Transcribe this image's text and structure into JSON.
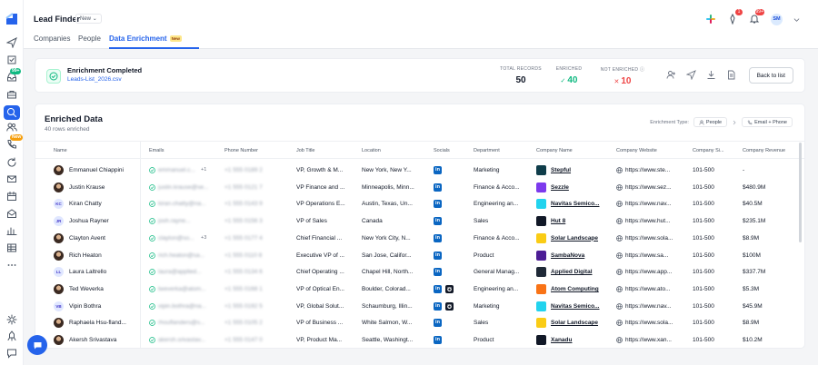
{
  "app": {
    "title": "Lead Finder",
    "version_label": "New"
  },
  "topbar": {
    "avatar_initials": "SM",
    "badges": [
      "1",
      "99+"
    ]
  },
  "sidebar": {
    "leads_badge": "99+",
    "new_badge": "New",
    "icons": [
      "send-icon",
      "task-icon",
      "inbox-icon",
      "briefcase-icon",
      "search-icon",
      "users-icon",
      "phone-icon",
      "refresh-icon",
      "mail-icon",
      "calendar-icon",
      "mail-open-icon",
      "chart-icon",
      "table-icon",
      "more-icon",
      "settings-icon",
      "rocket-icon",
      "chat-icon"
    ]
  },
  "tabs": [
    {
      "label": "Companies"
    },
    {
      "label": "People"
    },
    {
      "label": "Data Enrichment",
      "badge": "New"
    }
  ],
  "summary": {
    "title": "Enrichment Completed",
    "file": "Leads-List_2026.csv",
    "total_label": "TOTAL RECORDS",
    "total_value": "50",
    "enriched_label": "ENRICHED",
    "enriched_value": "40",
    "not_label": "NOT ENRICHED",
    "not_value": "10",
    "back_label": "Back to list"
  },
  "table": {
    "title": "Enriched Data",
    "subtitle": "40 rows enriched",
    "enrichment_type_label": "Enrichment Type:",
    "type_from": "People",
    "type_to": "Email + Phone",
    "columns": [
      "Name",
      "Emails",
      "Phone Number",
      "Job Title",
      "Location",
      "Socials",
      "Department",
      "Company Name",
      "Company Website",
      "Company Si...",
      "Company Revenue"
    ],
    "rows": [
      {
        "name": "Emmanuel Chiappini",
        "avatar": "photo",
        "initials": "",
        "email": "emmanuel.c...",
        "more": "+1",
        "phone": "+1 555 0189 2",
        "job": "VP, Growth & M...",
        "location": "New York, New Y...",
        "github": false,
        "dept": "Marketing",
        "company": "Stepful",
        "logo": "#0f3d4a",
        "website": "https://www.ste...",
        "size": "101-500",
        "revenue": "-"
      },
      {
        "name": "Justin Krause",
        "avatar": "photo",
        "initials": "",
        "email": "justin.krause@se...",
        "more": "",
        "phone": "+1 555 0121 7",
        "job": "VP Finance and ...",
        "location": "Minneapolis, Minn...",
        "github": false,
        "dept": "Finance & Acco...",
        "company": "Sezzle",
        "logo": "#7c3aed",
        "website": "https://www.sez...",
        "size": "101-500",
        "revenue": "$480.9M"
      },
      {
        "name": "Kiran Chatty",
        "avatar": "init",
        "initials": "KC",
        "email": "kiran.chatty@na...",
        "more": "",
        "phone": "+1 555 0143 9",
        "job": "VP Operations E...",
        "location": "Austin, Texas, Un...",
        "github": false,
        "dept": "Engineering an...",
        "company": "Navitas Semico...",
        "logo": "#22d3ee",
        "website": "https://www.nav...",
        "size": "101-500",
        "revenue": "$40.5M"
      },
      {
        "name": "Joshua Rayner",
        "avatar": "init",
        "initials": "JR",
        "email": "josh.rayne...",
        "more": "",
        "phone": "+1 555 0156 3",
        "job": "VP of Sales",
        "location": "Canada",
        "github": false,
        "dept": "Sales",
        "company": "Hut 8",
        "logo": "#111827",
        "website": "https://www.hut...",
        "size": "101-500",
        "revenue": "$235.1M"
      },
      {
        "name": "Clayton Avent",
        "avatar": "photo",
        "initials": "",
        "email": "clayton@so...",
        "more": "+3",
        "phone": "+1 555 0177 4",
        "job": "Chief Financial ...",
        "location": "New York City, N...",
        "github": false,
        "dept": "Finance & Acco...",
        "company": "Solar Landscape",
        "logo": "#facc15",
        "website": "https://www.sola...",
        "size": "101-500",
        "revenue": "$8.9M"
      },
      {
        "name": "Rich Heaton",
        "avatar": "photo",
        "initials": "",
        "email": "rich.heaton@sa...",
        "more": "",
        "phone": "+1 555 0110 8",
        "job": "Executive VP of ...",
        "location": "San Jose, Califor...",
        "github": false,
        "dept": "Product",
        "company": "SambaNova",
        "logo": "#4c1d95",
        "website": "https://www.sa...",
        "size": "101-500",
        "revenue": "$100M"
      },
      {
        "name": "Laura Laltrello",
        "avatar": "init",
        "initials": "LL",
        "email": "laura@applied...",
        "more": "",
        "phone": "+1 555 0134 6",
        "job": "Chief Operating ...",
        "location": "Chapel Hill, North...",
        "github": false,
        "dept": "General Manag...",
        "company": "Applied Digital",
        "logo": "#1f2937",
        "website": "https://www.app...",
        "size": "101-500",
        "revenue": "$337.7M"
      },
      {
        "name": "Ted Weverka",
        "avatar": "photo",
        "initials": "",
        "email": "tweverka@atom...",
        "more": "",
        "phone": "+1 555 0168 1",
        "job": "VP of Optical En...",
        "location": "Boulder, Colorad...",
        "github": true,
        "dept": "Engineering an...",
        "company": "Atom Computing",
        "logo": "#f97316",
        "website": "https://www.ato...",
        "size": "101-500",
        "revenue": "$5.3M"
      },
      {
        "name": "Vipin Bothra",
        "avatar": "init",
        "initials": "VB",
        "email": "vipin.bothra@na...",
        "more": "",
        "phone": "+1 555 0192 5",
        "job": "VP, Global Solut...",
        "location": "Schaumburg, Illin...",
        "github": true,
        "dept": "Marketing",
        "company": "Navitas Semico...",
        "logo": "#22d3ee",
        "website": "https://www.nav...",
        "size": "101-500",
        "revenue": "$45.9M"
      },
      {
        "name": "Raphaela Hsu-fland...",
        "avatar": "photo",
        "initials": "",
        "email": "rhouflanders@s...",
        "more": "",
        "phone": "+1 555 0105 2",
        "job": "VP of Business ...",
        "location": "White Salmon, W...",
        "github": false,
        "dept": "Sales",
        "company": "Solar Landscape",
        "logo": "#facc15",
        "website": "https://www.sola...",
        "size": "101-500",
        "revenue": "$8.9M"
      },
      {
        "name": "Akersh Srivastava",
        "avatar": "photo",
        "initials": "",
        "email": "akersh.srivastav...",
        "more": "",
        "phone": "+1 555 0147 0",
        "job": "VP, Product Ma...",
        "location": "Seattle, Washingt...",
        "github": false,
        "dept": "Product",
        "company": "Xanadu",
        "logo": "#111827",
        "website": "https://www.xan...",
        "size": "101-500",
        "revenue": "$10.2M"
      }
    ]
  }
}
